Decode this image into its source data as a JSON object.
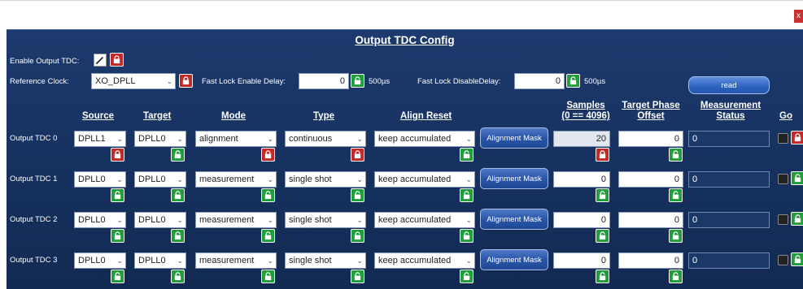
{
  "window": {
    "close_label": "x"
  },
  "panel": {
    "title": "Output TDC Config",
    "enable_output_tdc_label": "Enable Output TDC:",
    "reference_clock_label": "Reference Clock:",
    "reference_clock_value": "XO_DPLL",
    "fast_lock_enable_delay_label": "Fast Lock Enable Delay:",
    "fast_lock_enable_delay_value": "0",
    "fast_lock_enable_delay_unit": "500µs",
    "fast_lock_disable_delay_label": "Fast Lock DisableDelay:",
    "fast_lock_disable_delay_value": "0",
    "fast_lock_disable_delay_unit": "500µs",
    "read_button": "read"
  },
  "headers": {
    "source": "Source",
    "target": "Target",
    "mode": "Mode",
    "type": "Type",
    "align_reset": "Align Reset",
    "samples": "Samples",
    "samples_range": "(0 == 4096)",
    "target_phase": "Target Phase",
    "offset": "Offset",
    "measurement": "Measurement",
    "status": "Status",
    "go": "Go"
  },
  "rows": [
    {
      "label": "Output TDC 0",
      "source": "DPLL1",
      "target": "DPLL0",
      "mode": "alignment",
      "type": "continuous",
      "align_reset": "keep accumulated",
      "alignment_mask": "Alignment Mask",
      "samples": "20",
      "target_phase_offset": "0",
      "measurement_status": "0"
    },
    {
      "label": "Output TDC 1",
      "source": "DPLL0",
      "target": "DPLL0",
      "mode": "measurement",
      "type": "single shot",
      "align_reset": "keep accumulated",
      "alignment_mask": "Alignment Mask",
      "samples": "0",
      "target_phase_offset": "0",
      "measurement_status": "0"
    },
    {
      "label": "Output TDC 2",
      "source": "DPLL0",
      "target": "DPLL0",
      "mode": "measurement",
      "type": "single shot",
      "align_reset": "keep accumulated",
      "alignment_mask": "Alignment Mask",
      "samples": "0",
      "target_phase_offset": "0",
      "measurement_status": "0"
    },
    {
      "label": "Output TDC 3",
      "source": "DPLL0",
      "target": "DPLL0",
      "mode": "measurement",
      "type": "single shot",
      "align_reset": "keep accumulated",
      "alignment_mask": "Alignment Mask",
      "samples": "0",
      "target_phase_offset": "0",
      "measurement_status": "0"
    }
  ],
  "icons": {
    "dropdown": "chevron-down-icon",
    "lock_closed": "lock-closed-icon",
    "lock_open": "lock-open-icon",
    "edit": "pencil-icon"
  },
  "colors": {
    "panel_bg": "#1d3a6e",
    "lock_red": "#c62828",
    "lock_green": "#1f9e3a",
    "button_blue": "#2a56a8"
  }
}
